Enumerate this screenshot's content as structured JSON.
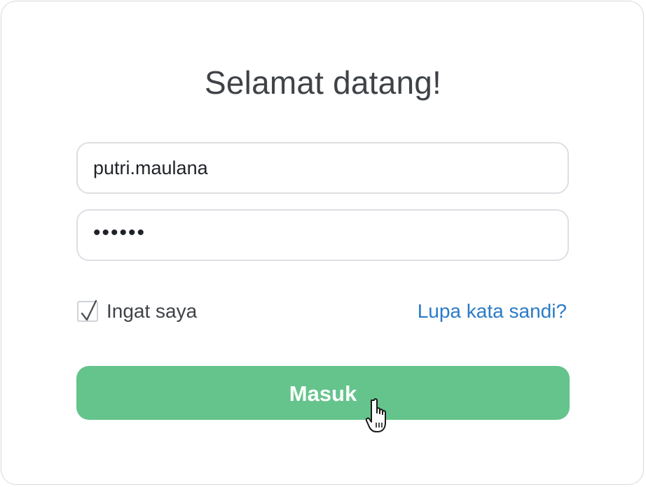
{
  "login": {
    "title": "Selamat datang!",
    "username_value": "putri.maulana",
    "password_masked": "••••••",
    "remember_label": "Ingat saya",
    "remember_checked": true,
    "forgot_label": "Lupa kata sandi?",
    "submit_label": "Masuk"
  },
  "colors": {
    "accent": "#64c48c",
    "link": "#2b7bc6",
    "title_text": "#3f4348",
    "border": "#dcdfe3"
  },
  "icons": {
    "checkbox_mark": "checkmark-icon",
    "pointer": "hand-pointer-icon"
  }
}
